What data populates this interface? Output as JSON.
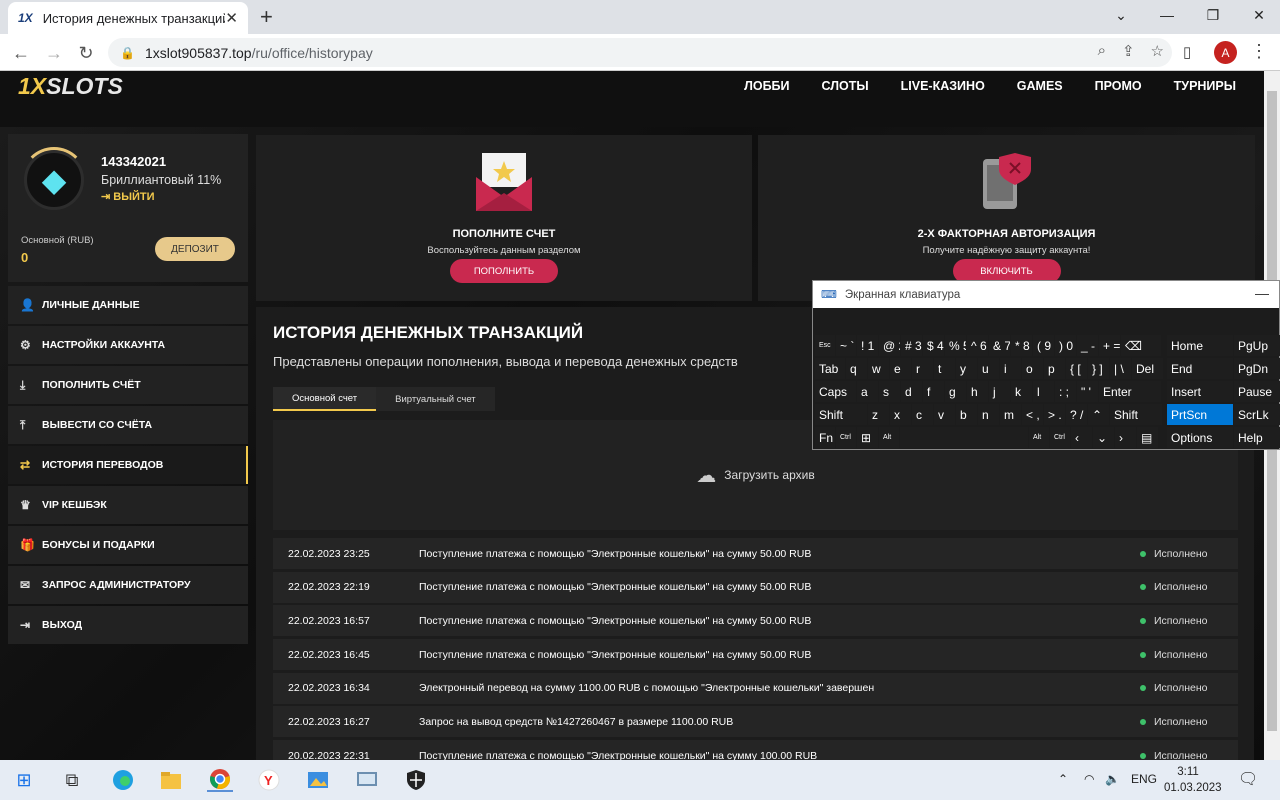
{
  "browser": {
    "tab_title": "История денежных транзакций",
    "tab_favicon": "1X",
    "tab_close": "✕",
    "new_tab": "+",
    "url_host": "1xslot905837.top",
    "url_path": "/ru/office/historypay",
    "profile_initial": "A",
    "window_minimize": "⌄",
    "window_min": "—",
    "window_restore": "❐",
    "window_close": "✕"
  },
  "site": {
    "logo_prefix": "1X",
    "logo_suffix": "SLOTS",
    "nav": [
      "ЛОББИ",
      "СЛОТЫ",
      "LIVE-КАЗИНО",
      "GAMES",
      "ПРОМО",
      "ТУРНИРЫ"
    ]
  },
  "profile": {
    "user_id": "143342021",
    "level": "Бриллиантовый 11%",
    "logout": "ВЫЙТИ",
    "account_label": "Основной (RUB)",
    "balance": "0",
    "deposit_button": "ДЕПОЗИТ"
  },
  "menu": [
    {
      "label": "ЛИЧНЫЕ ДАННЫЕ",
      "icon": "user-icon",
      "glyph": "👤"
    },
    {
      "label": "НАСТРОЙКИ АККАУНТА",
      "icon": "settings-icon",
      "glyph": "⚙"
    },
    {
      "label": "ПОПОЛНИТЬ СЧЁТ",
      "icon": "download-icon",
      "glyph": "⤓"
    },
    {
      "label": "ВЫВЕСТИ СО СЧЁТА",
      "icon": "upload-icon",
      "glyph": "⤒"
    },
    {
      "label": "ИСТОРИЯ ПЕРЕВОДОВ",
      "icon": "transfer-icon",
      "glyph": "⇄"
    },
    {
      "label": "VIP КЕШБЭК",
      "icon": "vip-icon",
      "glyph": "♛"
    },
    {
      "label": "БОНУСЫ И ПОДАРКИ",
      "icon": "gift-icon",
      "glyph": "🎁"
    },
    {
      "label": "ЗАПРОС АДМИНИСТРАТОРУ",
      "icon": "mail-icon",
      "glyph": "✉"
    },
    {
      "label": "ВЫХОД",
      "icon": "exit-icon",
      "glyph": "⇥"
    }
  ],
  "cards": {
    "deposit": {
      "title": "ПОПОЛНИТЕ СЧЕТ",
      "subtitle": "Воспользуйтесь данным разделом",
      "button": "ПОПОЛНИТЬ"
    },
    "twofa": {
      "title": "2-Х ФАКТОРНАЯ АВТОРИЗАЦИЯ",
      "subtitle": "Получите надёжную защиту аккаунта!",
      "button": "ВКЛЮЧИТЬ"
    }
  },
  "history": {
    "title": "ИСТОРИЯ ДЕНЕЖНЫХ ТРАНЗАКЦИЙ",
    "subtitle": "Представлены операции пополнения, вывода и перевода денежных средств",
    "tabs": [
      "Основной счет",
      "Виртуальный счет"
    ],
    "archive_label": "Загрузить архив",
    "rows": [
      {
        "date": "22.02.2023 23:25",
        "desc": "Поступление платежа с помощью \"Электронные кошельки\" на сумму 50.00 RUB",
        "status": "Исполнено"
      },
      {
        "date": "22.02.2023 22:19",
        "desc": "Поступление платежа с помощью \"Электронные кошельки\" на сумму 50.00 RUB",
        "status": "Исполнено"
      },
      {
        "date": "22.02.2023 16:57",
        "desc": "Поступление платежа с помощью \"Электронные кошельки\" на сумму 50.00 RUB",
        "status": "Исполнено"
      },
      {
        "date": "22.02.2023 16:45",
        "desc": "Поступление платежа с помощью \"Электронные кошельки\" на сумму 50.00 RUB",
        "status": "Исполнено"
      },
      {
        "date": "22.02.2023 16:34",
        "desc": "Электронный перевод на сумму 1100.00 RUB с помощью \"Электронные кошельки\" завершен",
        "status": "Исполнено"
      },
      {
        "date": "22.02.2023 16:27",
        "desc": "Запрос на вывод средств №1427260467 в размере 1100.00 RUB",
        "status": "Исполнено"
      },
      {
        "date": "20.02.2023 22:31",
        "desc": "Поступление платежа с помощью \"Электронные кошельки\" на сумму 100.00 RUB",
        "status": "Исполнено"
      }
    ]
  },
  "osk": {
    "title": "Экранная клавиатура",
    "minimize": "—",
    "rows": [
      [
        {
          "l": "Esc",
          "w": 20,
          "s": 1
        },
        {
          "l": "~ `",
          "w": 20
        },
        {
          "l": "! 1",
          "w": 21
        },
        {
          "l": "@ 2",
          "w": 21
        },
        {
          "l": "# 3",
          "w": 21
        },
        {
          "l": "$ 4",
          "w": 21
        },
        {
          "l": "% 5",
          "w": 21
        },
        {
          "l": "^ 6",
          "w": 21
        },
        {
          "l": "& 7",
          "w": 21
        },
        {
          "l": "* 8",
          "w": 21
        },
        {
          "l": "( 9",
          "w": 21
        },
        {
          "l": ") 0",
          "w": 21
        },
        {
          "l": "_ -",
          "w": 21
        },
        {
          "l": "+ =",
          "w": 21
        },
        {
          "l": "⌫",
          "w": 40
        }
      ],
      [
        {
          "l": "Tab",
          "w": 30
        },
        {
          "l": "q",
          "w": 21
        },
        {
          "l": "w",
          "w": 21
        },
        {
          "l": "e",
          "w": 21
        },
        {
          "l": "r",
          "w": 21
        },
        {
          "l": "t",
          "w": 21
        },
        {
          "l": "y",
          "w": 21
        },
        {
          "l": "u",
          "w": 21
        },
        {
          "l": "i",
          "w": 21
        },
        {
          "l": "o",
          "w": 21
        },
        {
          "l": "p",
          "w": 21
        },
        {
          "l": "{ [",
          "w": 21
        },
        {
          "l": "} ]",
          "w": 21
        },
        {
          "l": "| \\",
          "w": 21
        },
        {
          "l": "Del",
          "w": 31
        }
      ],
      [
        {
          "l": "Caps",
          "w": 41
        },
        {
          "l": "a",
          "w": 21
        },
        {
          "l": "s",
          "w": 21
        },
        {
          "l": "d",
          "w": 21
        },
        {
          "l": "f",
          "w": 21
        },
        {
          "l": "g",
          "w": 21
        },
        {
          "l": "h",
          "w": 21
        },
        {
          "l": "j",
          "w": 21
        },
        {
          "l": "k",
          "w": 21
        },
        {
          "l": "l",
          "w": 21
        },
        {
          "l": ": ;",
          "w": 21
        },
        {
          "l": "\" '",
          "w": 21
        },
        {
          "l": "Enter",
          "w": 62
        }
      ],
      [
        {
          "l": "Shift",
          "w": 52
        },
        {
          "l": "z",
          "w": 21
        },
        {
          "l": "x",
          "w": 21
        },
        {
          "l": "c",
          "w": 21
        },
        {
          "l": "v",
          "w": 21
        },
        {
          "l": "b",
          "w": 21
        },
        {
          "l": "n",
          "w": 21
        },
        {
          "l": "m",
          "w": 21
        },
        {
          "l": "< ,",
          "w": 21
        },
        {
          "l": "> .",
          "w": 21
        },
        {
          "l": "? /",
          "w": 21
        },
        {
          "l": "⌃",
          "w": 21
        },
        {
          "l": "Shift",
          "w": 52
        }
      ],
      [
        {
          "l": "Fn",
          "w": 20
        },
        {
          "l": "Ctrl",
          "w": 20,
          "s": 1
        },
        {
          "l": "⊞",
          "w": 21
        },
        {
          "l": "Alt",
          "w": 20,
          "s": 1
        },
        {
          "l": "",
          "w": 128
        },
        {
          "l": "Alt",
          "w": 20,
          "s": 1
        },
        {
          "l": "Ctrl",
          "w": 20,
          "s": 1
        },
        {
          "l": "‹",
          "w": 21
        },
        {
          "l": "⌄",
          "w": 21
        },
        {
          "l": "›",
          "w": 21
        },
        {
          "l": "▤",
          "w": 21
        }
      ]
    ],
    "nav_keys": [
      [
        "Home",
        "PgUp"
      ],
      [
        "End",
        "PgDn"
      ],
      [
        "Insert",
        "Pause"
      ],
      [
        "PrtScn",
        "ScrLk"
      ],
      [
        "Options",
        "Help"
      ]
    ]
  },
  "taskbar": {
    "language": "ENG",
    "time": "3:11",
    "date": "01.03.2023"
  }
}
